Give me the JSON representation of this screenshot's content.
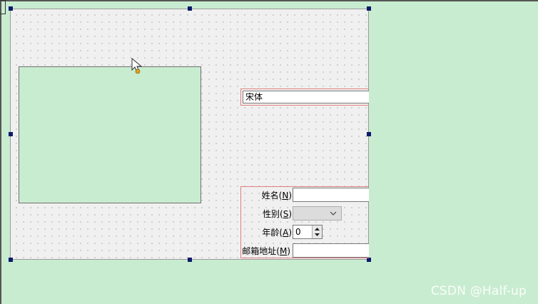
{
  "font_combo": {
    "value": "宋体"
  },
  "fields": [
    {
      "label": "姓名",
      "mnemonic": "N"
    },
    {
      "label": "性别",
      "mnemonic": "S"
    },
    {
      "label": "年龄",
      "mnemonic": "A"
    },
    {
      "label": "邮箱地址",
      "mnemonic": "M"
    }
  ],
  "age_spin": {
    "value": "0"
  },
  "icons": [
    "arrow-cursor-icon",
    "chevron-down-icon",
    "spin-up-icon",
    "spin-down-icon"
  ],
  "watermark": "CSDN @Half-up",
  "colors": {
    "background": "#c8ecd0",
    "form_background": "#f0f0f0",
    "selection_handle": "#0a1b6b",
    "layout_border": "#e08080"
  }
}
